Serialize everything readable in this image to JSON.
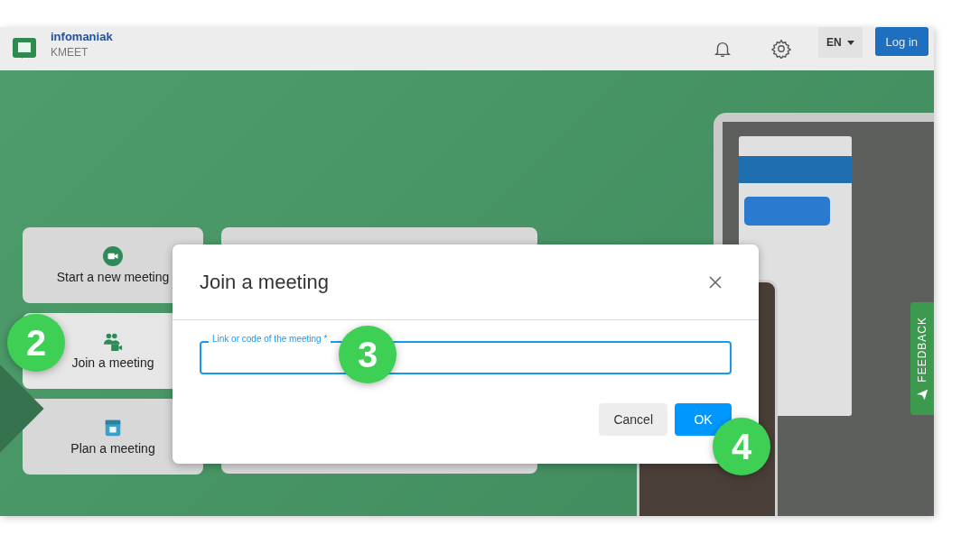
{
  "header": {
    "brand": "infomaniak",
    "product": "KMEET",
    "language": "EN",
    "login_button": "Log in"
  },
  "actions": [
    {
      "label": "Start a new meeting",
      "kind": "video",
      "selected": false
    },
    {
      "label": "Join a meeting",
      "kind": "people",
      "selected": true
    },
    {
      "label": "Plan a meeting",
      "kind": "calendar",
      "selected": false
    }
  ],
  "dialog": {
    "title": "Join a meeting",
    "field": {
      "label": "Link or code of the meeting *"
    },
    "buttons": [
      {
        "label": "Cancel",
        "kind": "secondary"
      },
      {
        "label": "OK",
        "kind": "primary"
      }
    ]
  },
  "feedback_tab": "FEEDBACK",
  "callouts": [
    "2",
    "3",
    "4"
  ]
}
